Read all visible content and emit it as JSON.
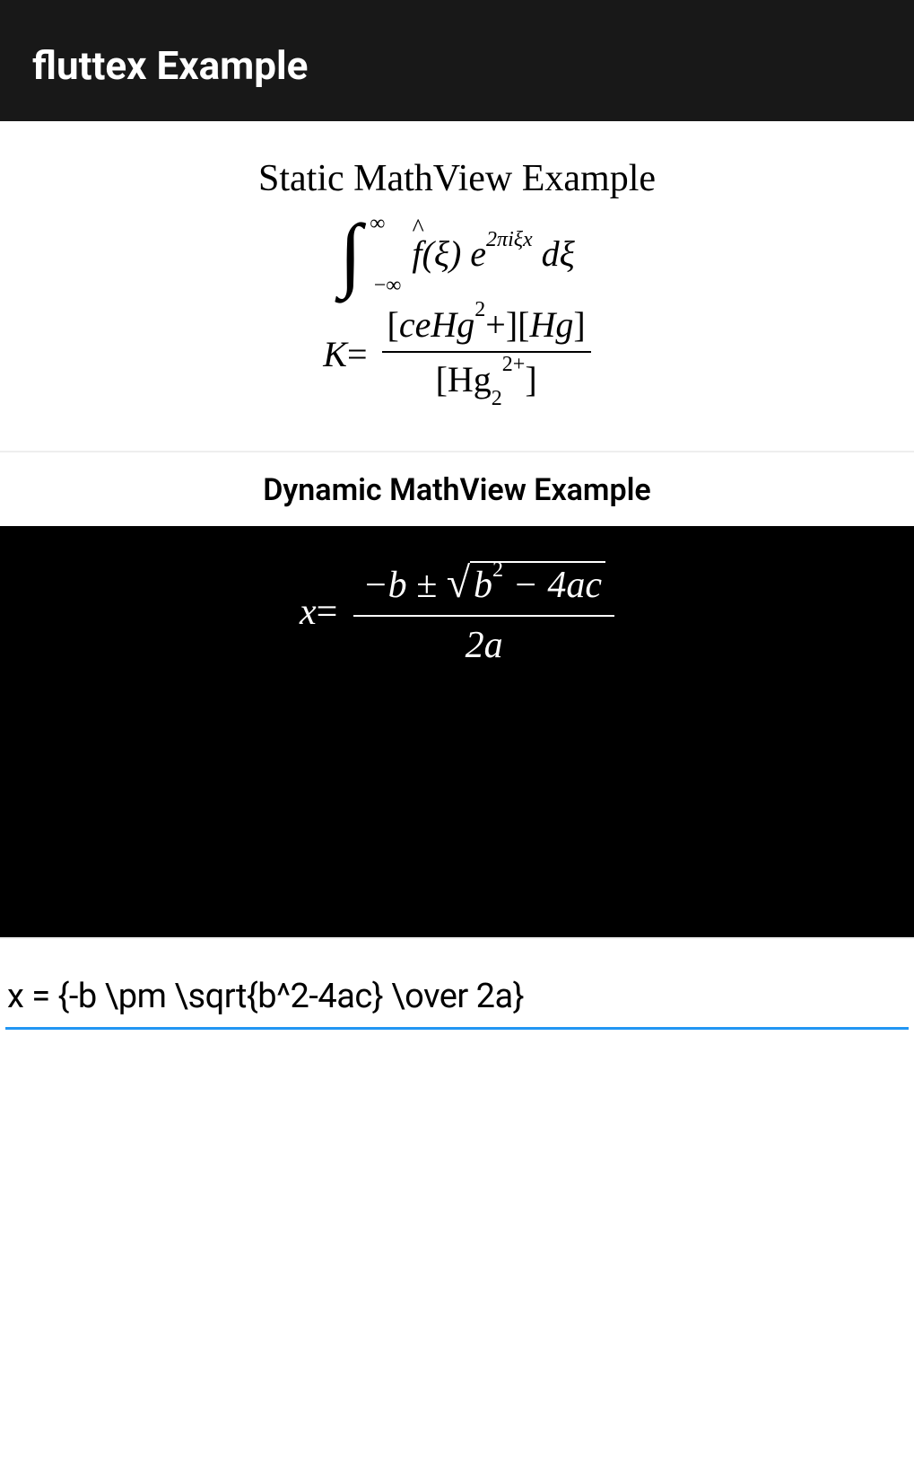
{
  "appBar": {
    "title": "fluttex Example"
  },
  "staticSection": {
    "title": "Static MathView Example",
    "integral": {
      "upperLimit": "∞",
      "lowerLimit": "−∞",
      "fhat": "f",
      "arg": "(ξ) ",
      "eBase": "e",
      "eExponent": "2πiξx",
      "dxi": " dξ"
    },
    "kEquation": {
      "lhs": "K ",
      "eq": "= ",
      "num": "[ceHg²+][Hg]",
      "den_open": "[Hg",
      "den_sub": "2",
      "den_sup": "2+",
      "den_close": "]"
    }
  },
  "dynamicSection": {
    "title": "Dynamic MathView Example",
    "quadratic": {
      "lhs": "x ",
      "eq": "= ",
      "num_lead": "−b ± ",
      "sqrt_content_b": "b",
      "sqrt_content_exp": "2",
      "sqrt_content_tail": " − 4ac",
      "den": "2a"
    }
  },
  "input": {
    "value": "x = {-b \\pm \\sqrt{b^2-4ac} \\over 2a}"
  }
}
